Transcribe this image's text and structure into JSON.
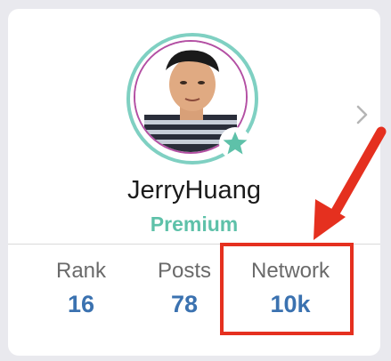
{
  "profile": {
    "username": "JerryHuang",
    "tier": "Premium"
  },
  "stats": [
    {
      "label": "Rank",
      "value": "16"
    },
    {
      "label": "Posts",
      "value": "78"
    },
    {
      "label": "Network",
      "value": "10k"
    }
  ],
  "colors": {
    "accent_teal": "#5ec1a9",
    "value_blue": "#3b72b0",
    "annotation_red": "#e5301f",
    "avatar_ring_outer": "#7fd0c2",
    "avatar_ring_inner": "#b34fa3"
  },
  "icons": {
    "chevron": "chevron-right-icon",
    "badge": "star-icon"
  }
}
